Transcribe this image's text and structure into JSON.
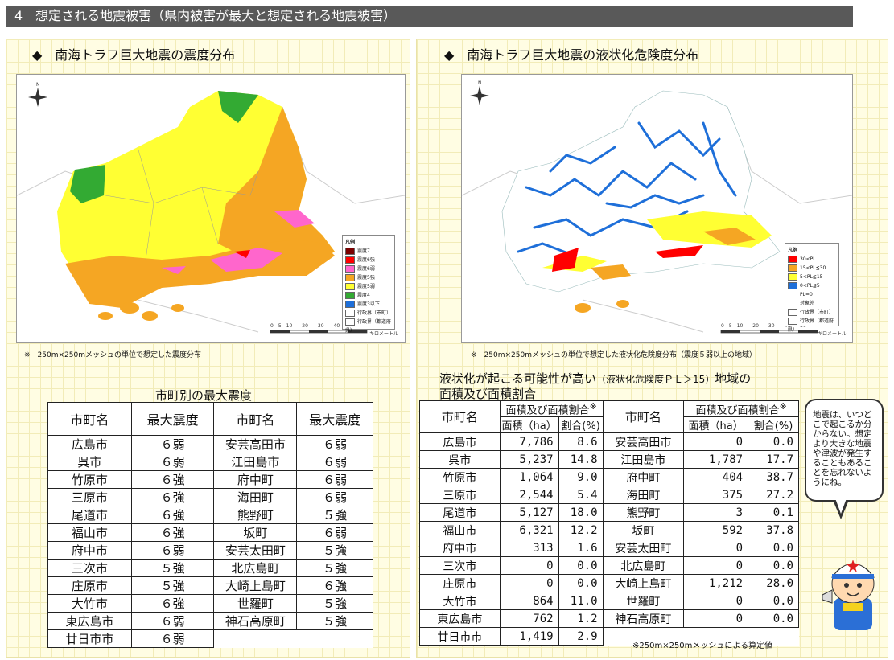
{
  "header": {
    "title": "4　想定される地震被害（県内被害が最大と想定される地震被害）"
  },
  "left": {
    "title": "◆　南海トラフ巨大地震の震度分布",
    "note": "※　250m×250mメッシュの単位で想定した震度分布",
    "legend": {
      "title": "凡例",
      "items": [
        "震度7",
        "震度6強",
        "震度6弱",
        "震度5強",
        "震度5弱",
        "震度4",
        "震度3以下",
        "行政界（市町）",
        "行政界（都道府県）"
      ]
    },
    "scale": "0　5　10　　20　　30　　40　　50",
    "scale_unit": "キロメートル",
    "table_caption": "市町別の最大震度",
    "table_headers": [
      "市町名",
      "最大震度",
      "市町名",
      "最大震度"
    ],
    "rows": [
      [
        "広島市",
        "６弱",
        "安芸高田市",
        "６弱"
      ],
      [
        "呉市",
        "６弱",
        "江田島市",
        "６弱"
      ],
      [
        "竹原市",
        "６強",
        "府中町",
        "６弱"
      ],
      [
        "三原市",
        "６強",
        "海田町",
        "６弱"
      ],
      [
        "尾道市",
        "６強",
        "熊野町",
        "５強"
      ],
      [
        "福山市",
        "６強",
        "坂町",
        "６弱"
      ],
      [
        "府中市",
        "６弱",
        "安芸太田町",
        "５強"
      ],
      [
        "三次市",
        "５強",
        "北広島町",
        "５強"
      ],
      [
        "庄原市",
        "５強",
        "大崎上島町",
        "６強"
      ],
      [
        "大竹市",
        "６強",
        "世羅町",
        "５強"
      ],
      [
        "東広島市",
        "６弱",
        "神石高原町",
        "５強"
      ]
    ],
    "last_row": [
      "廿日市市",
      "６弱"
    ]
  },
  "right": {
    "title": "◆　南海トラフ巨大地震の液状化危険度分布",
    "note": "※　250m×250mメッシュの単位で想定した液状化危険度分布（震度５弱以上の地域）",
    "legend": {
      "title": "凡例",
      "items": [
        "30<PL",
        "15<PL≦30",
        "5<PL≦15",
        "0<PL≦5",
        "PL=0",
        "対象外",
        "行政界（市町）",
        "行政界（都道府県）"
      ]
    },
    "scale": "0　5　10　　20　　30　　40　　50",
    "scale_unit": "キロメートル",
    "caption_line1": "液状化が起こる可能性が高い",
    "caption_small": "（液状化危険度ＰＬ＞15）",
    "caption_tail": "地域の",
    "caption_line2": "面積及び面積割合",
    "table_headers": {
      "name": "市町名",
      "group": "面積及び面積割合",
      "mark": "※",
      "area": "面積（ha）",
      "ratio": "割合(%)"
    },
    "rows": [
      [
        "広島市",
        "7,786",
        "8.6",
        "安芸高田市",
        "0",
        "0.0"
      ],
      [
        "呉市",
        "5,237",
        "14.8",
        "江田島市",
        "1,787",
        "17.7"
      ],
      [
        "竹原市",
        "1,064",
        "9.0",
        "府中町",
        "404",
        "38.7"
      ],
      [
        "三原市",
        "2,544",
        "5.4",
        "海田町",
        "375",
        "27.2"
      ],
      [
        "尾道市",
        "5,127",
        "18.0",
        "熊野町",
        "3",
        "0.1"
      ],
      [
        "福山市",
        "6,321",
        "12.2",
        "坂町",
        "592",
        "37.8"
      ],
      [
        "府中市",
        "313",
        "1.6",
        "安芸太田町",
        "0",
        "0.0"
      ],
      [
        "三次市",
        "0",
        "0.0",
        "北広島町",
        "0",
        "0.0"
      ],
      [
        "庄原市",
        "0",
        "0.0",
        "大崎上島町",
        "1,212",
        "28.0"
      ],
      [
        "大竹市",
        "864",
        "11.0",
        "世羅町",
        "0",
        "0.0"
      ],
      [
        "東広島市",
        "762",
        "1.2",
        "神石高原町",
        "0",
        "0.0"
      ]
    ],
    "last_row": [
      "廿日市市",
      "1,419",
      "2.9"
    ],
    "footnote": "※250m×250mメッシュによる算定値"
  },
  "bubble": {
    "text": "地震は、いつどこで起こるか分からない。想定より大きな地震や津波が発生することもあることを忘れないようにね。"
  },
  "colors": {
    "header": "#595959",
    "panel": "#fffde3",
    "s7": "#7a0000",
    "s6u": "#ff0000",
    "s6l": "#ff66cc",
    "s5u": "#f5a623",
    "s5l": "#ffff33",
    "s4": "#33aa33",
    "s3": "#1e6fd9"
  }
}
